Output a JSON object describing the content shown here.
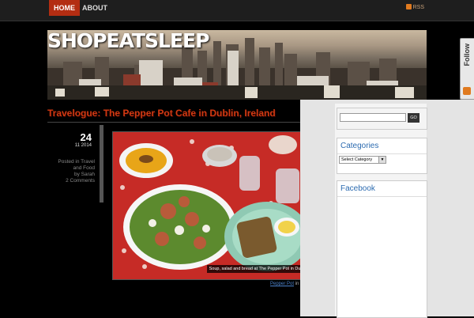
{
  "nav": {
    "items": [
      {
        "label": "HOME",
        "active": true
      },
      {
        "label": "ABOUT",
        "active": false
      }
    ],
    "rss_label": "RSS"
  },
  "header": {
    "site_title": "SHOPEATSLEEP"
  },
  "follow_tab": {
    "label": "Follow"
  },
  "post": {
    "title": "Travelogue: The Pepper Pot Cafe in Dublin, Ireland",
    "date_day": "24",
    "date_month": "11 2014",
    "meta_lines": [
      "Posted in Travel",
      "and Food",
      "by Sarah",
      "2 Comments"
    ],
    "image_caption": "Soup, salad and bread at The Pepper Pot in Dublin",
    "after_link": "Pepper Pot",
    "after_text": "in"
  },
  "sidebar": {
    "search_placeholder": "",
    "search_button": "GO",
    "categories_title": "Categories",
    "categories_select": "Select Category",
    "facebook_title": "Facebook"
  },
  "colors": {
    "accent": "#b32d12",
    "title_red": "#d23a12",
    "widget_title_blue": "#2c6bb0"
  }
}
